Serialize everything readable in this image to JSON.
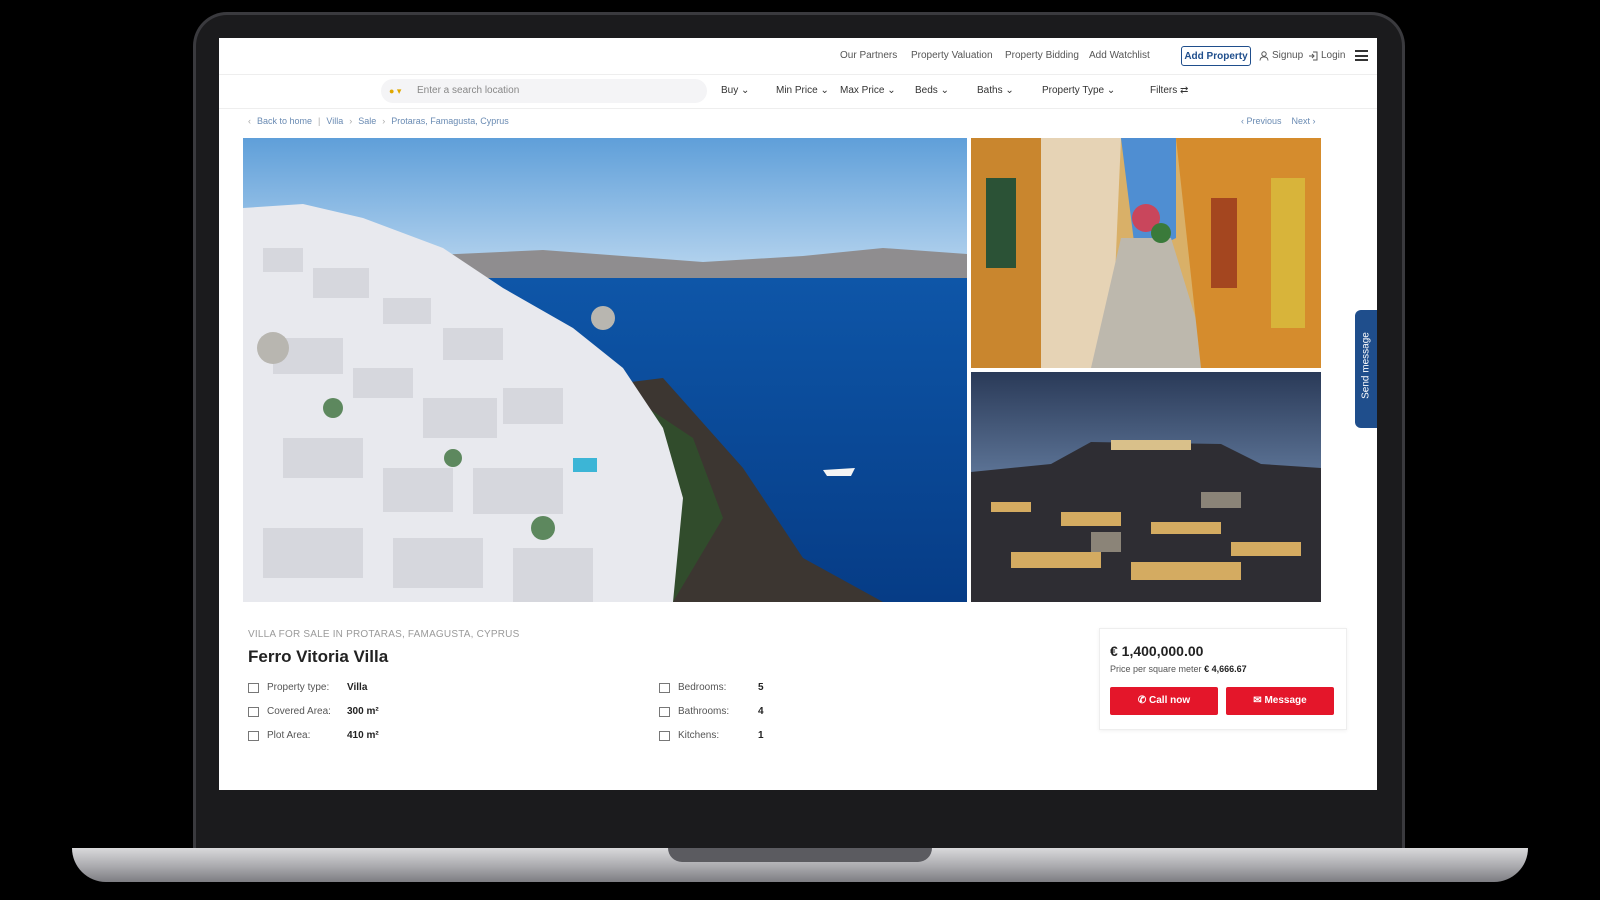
{
  "top_nav": {
    "links": [
      "Our Partners",
      "Property Valuation",
      "Property Bidding",
      "Add Watchlist"
    ],
    "add_property": "Add Property",
    "signup": "Signup",
    "login": "Login"
  },
  "search": {
    "placeholder": "Enter a search location",
    "filters": [
      "Buy",
      "Min Price",
      "Max Price",
      "Beds",
      "Baths",
      "Property Type",
      "Filters"
    ]
  },
  "breadcrumb": [
    "Back to home",
    "Villa",
    "Sale",
    "Protaras, Famagusta, Cyprus"
  ],
  "pager": {
    "previous": "Previous",
    "next": "Next"
  },
  "side_tab": "Send message",
  "listing": {
    "subtitle": "VILLA FOR SALE IN PROTARAS, FAMAGUSTA, CYPRUS",
    "title": "Ferro Vitoria Villa",
    "specs_left": [
      {
        "label": "Property type:",
        "value": "Villa"
      },
      {
        "label": "Covered Area:",
        "value": "300 m²"
      },
      {
        "label": "Plot Area:",
        "value": "410 m²"
      }
    ],
    "specs_right": [
      {
        "label": "Bedrooms:",
        "value": "5"
      },
      {
        "label": "Bathrooms:",
        "value": "4"
      },
      {
        "label": "Kitchens:",
        "value": "1"
      }
    ]
  },
  "price_card": {
    "price": "€ 1,400,000.00",
    "per_sqm_label": "Price per square meter",
    "per_sqm_value": "€ 4,666.67",
    "call_label": "Call now",
    "message_label": "Message",
    "button_color": "#e4162a"
  },
  "colors": {
    "accent": "#1f4e8c"
  }
}
